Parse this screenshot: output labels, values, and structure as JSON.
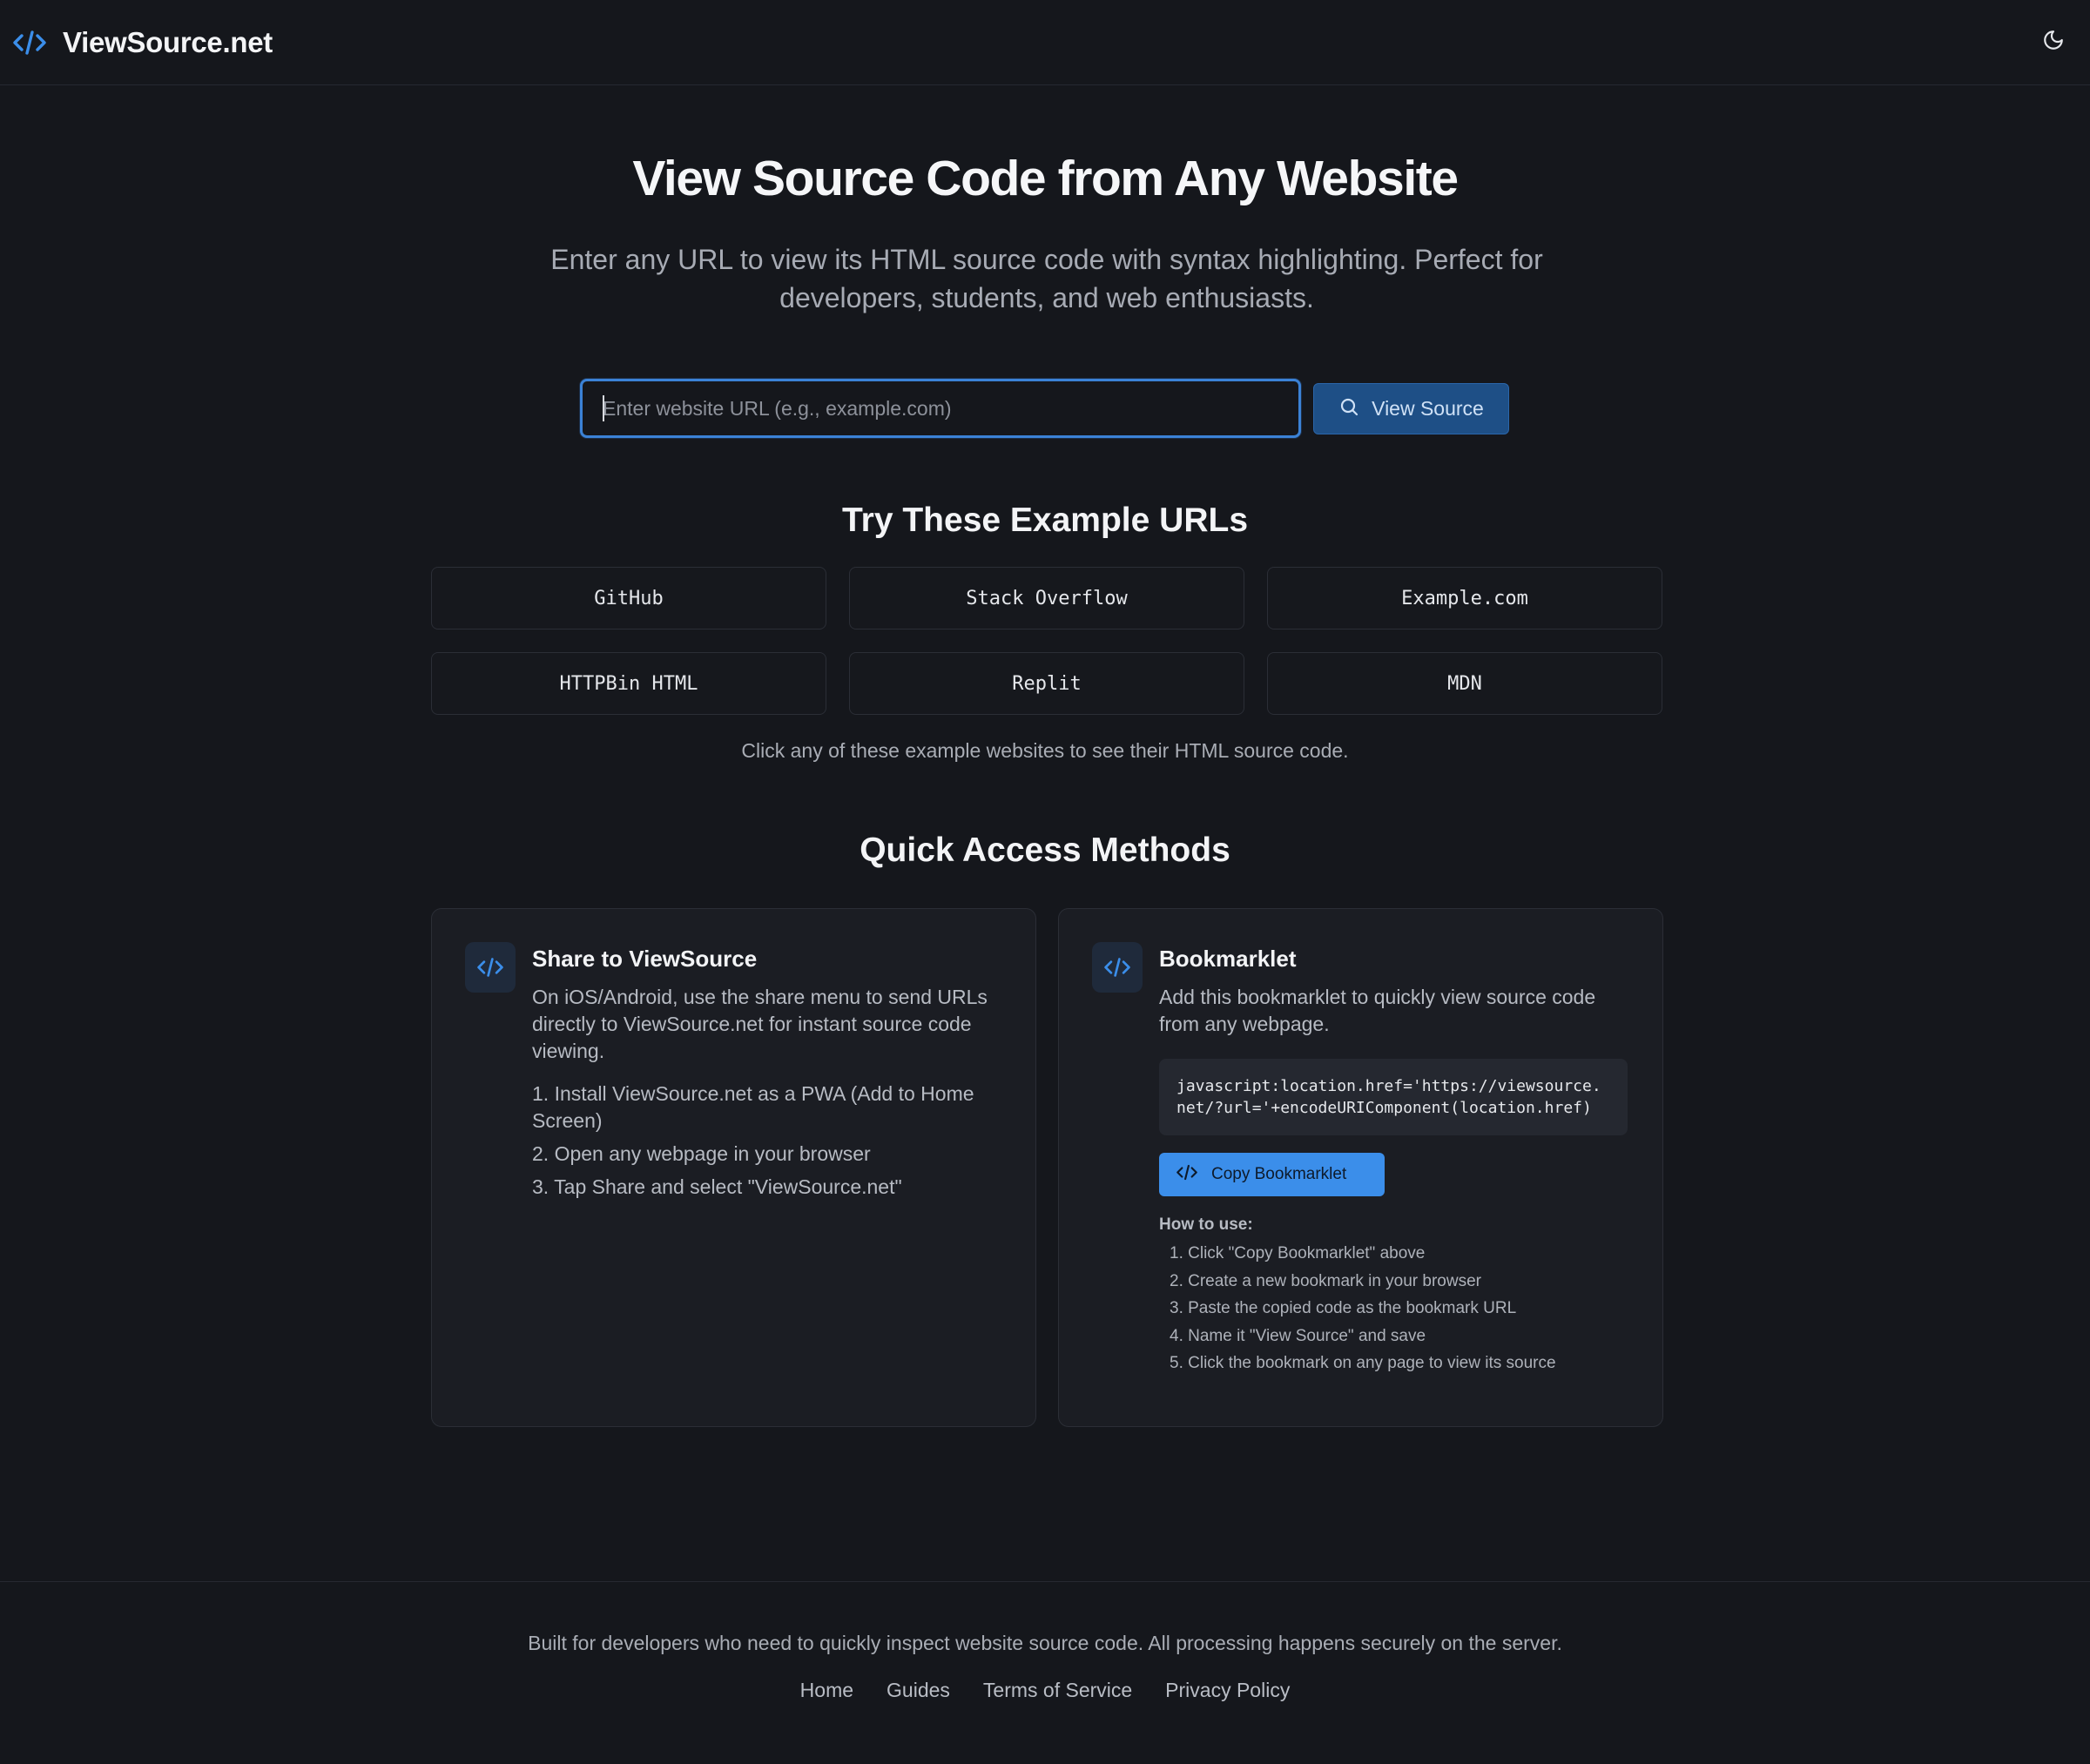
{
  "header": {
    "brand_name": "ViewSource.net",
    "brand_icon": "code-icon",
    "theme_icon": "moon-icon"
  },
  "hero": {
    "title": "View Source Code from Any Website",
    "subtitle": "Enter any URL to view its HTML source code with syntax highlighting. Perfect for developers, students, and web enthusiasts."
  },
  "search": {
    "placeholder": "Enter website URL (e.g., example.com)",
    "value": "",
    "button_label": "View Source",
    "button_icon": "search-icon"
  },
  "examples": {
    "title": "Try These Example URLs",
    "items": [
      "GitHub",
      "Stack Overflow",
      "Example.com",
      "HTTPBin HTML",
      "Replit",
      "MDN"
    ],
    "note": "Click any of these example websites to see their HTML source code."
  },
  "quick_access": {
    "title": "Quick Access Methods",
    "share": {
      "title": "Share to ViewSource",
      "description": "On iOS/Android, use the share menu to send URLs directly to ViewSource.net for instant source code viewing.",
      "steps": [
        "1. Install ViewSource.net as a PWA (Add to Home Screen)",
        "2. Open any webpage in your browser",
        "3. Tap Share and select \"ViewSource.net\""
      ]
    },
    "bookmarklet": {
      "title": "Bookmarklet",
      "description": "Add this bookmarklet to quickly view source code from any webpage.",
      "code": "javascript:location.href='https://viewsource.net/?url='+encodeURIComponent(location.href)",
      "copy_label": "Copy Bookmarklet",
      "howto_title": "How to use:",
      "howto_steps": [
        "1. Click \"Copy Bookmarklet\" above",
        "2. Create a new bookmark in your browser",
        "3. Paste the copied code as the bookmark URL",
        "4. Name it \"View Source\" and save",
        "5. Click the bookmark on any page to view its source"
      ]
    }
  },
  "footer": {
    "text": "Built for developers who need to quickly inspect website source code. All processing happens securely on the server.",
    "links": [
      "Home",
      "Guides",
      "Terms of Service",
      "Privacy Policy"
    ]
  },
  "colors": {
    "background": "#15171c",
    "accent": "#3b8eea",
    "input_border": "#3b82d6",
    "card_background": "#1b1d23"
  }
}
